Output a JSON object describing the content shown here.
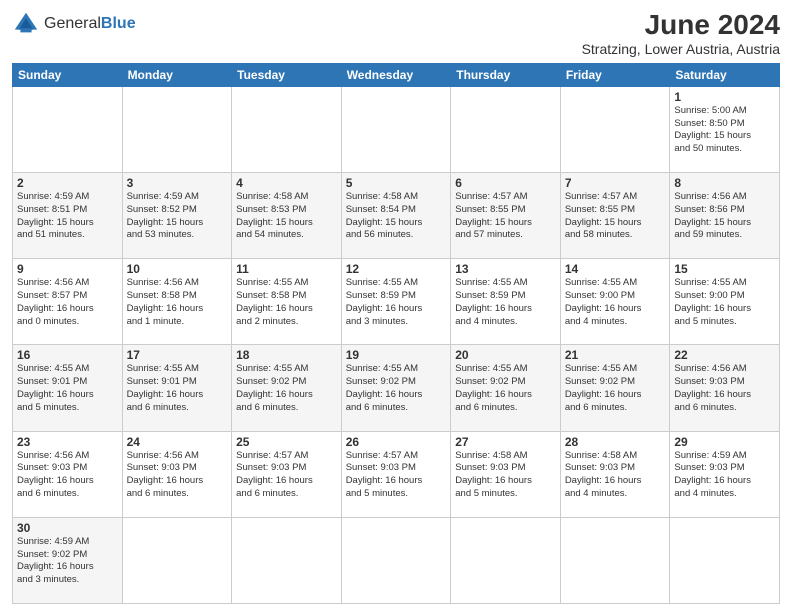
{
  "logo": {
    "text_general": "General",
    "text_blue": "Blue"
  },
  "title": "June 2024",
  "subtitle": "Stratzing, Lower Austria, Austria",
  "days_of_week": [
    "Sunday",
    "Monday",
    "Tuesday",
    "Wednesday",
    "Thursday",
    "Friday",
    "Saturday"
  ],
  "weeks": [
    [
      {
        "day": "",
        "info": ""
      },
      {
        "day": "",
        "info": ""
      },
      {
        "day": "",
        "info": ""
      },
      {
        "day": "",
        "info": ""
      },
      {
        "day": "",
        "info": ""
      },
      {
        "day": "",
        "info": ""
      },
      {
        "day": "1",
        "info": "Sunrise: 5:00 AM\nSunset: 8:50 PM\nDaylight: 15 hours\nand 50 minutes."
      }
    ],
    [
      {
        "day": "2",
        "info": "Sunrise: 4:59 AM\nSunset: 8:51 PM\nDaylight: 15 hours\nand 51 minutes."
      },
      {
        "day": "3",
        "info": "Sunrise: 4:59 AM\nSunset: 8:52 PM\nDaylight: 15 hours\nand 53 minutes."
      },
      {
        "day": "4",
        "info": "Sunrise: 4:58 AM\nSunset: 8:53 PM\nDaylight: 15 hours\nand 54 minutes."
      },
      {
        "day": "5",
        "info": "Sunrise: 4:58 AM\nSunset: 8:54 PM\nDaylight: 15 hours\nand 56 minutes."
      },
      {
        "day": "6",
        "info": "Sunrise: 4:57 AM\nSunset: 8:55 PM\nDaylight: 15 hours\nand 57 minutes."
      },
      {
        "day": "7",
        "info": "Sunrise: 4:57 AM\nSunset: 8:55 PM\nDaylight: 15 hours\nand 58 minutes."
      },
      {
        "day": "8",
        "info": "Sunrise: 4:56 AM\nSunset: 8:56 PM\nDaylight: 15 hours\nand 59 minutes."
      }
    ],
    [
      {
        "day": "9",
        "info": "Sunrise: 4:56 AM\nSunset: 8:57 PM\nDaylight: 16 hours\nand 0 minutes."
      },
      {
        "day": "10",
        "info": "Sunrise: 4:56 AM\nSunset: 8:58 PM\nDaylight: 16 hours\nand 1 minute."
      },
      {
        "day": "11",
        "info": "Sunrise: 4:55 AM\nSunset: 8:58 PM\nDaylight: 16 hours\nand 2 minutes."
      },
      {
        "day": "12",
        "info": "Sunrise: 4:55 AM\nSunset: 8:59 PM\nDaylight: 16 hours\nand 3 minutes."
      },
      {
        "day": "13",
        "info": "Sunrise: 4:55 AM\nSunset: 8:59 PM\nDaylight: 16 hours\nand 4 minutes."
      },
      {
        "day": "14",
        "info": "Sunrise: 4:55 AM\nSunset: 9:00 PM\nDaylight: 16 hours\nand 4 minutes."
      },
      {
        "day": "15",
        "info": "Sunrise: 4:55 AM\nSunset: 9:00 PM\nDaylight: 16 hours\nand 5 minutes."
      }
    ],
    [
      {
        "day": "16",
        "info": "Sunrise: 4:55 AM\nSunset: 9:01 PM\nDaylight: 16 hours\nand 5 minutes."
      },
      {
        "day": "17",
        "info": "Sunrise: 4:55 AM\nSunset: 9:01 PM\nDaylight: 16 hours\nand 6 minutes."
      },
      {
        "day": "18",
        "info": "Sunrise: 4:55 AM\nSunset: 9:02 PM\nDaylight: 16 hours\nand 6 minutes."
      },
      {
        "day": "19",
        "info": "Sunrise: 4:55 AM\nSunset: 9:02 PM\nDaylight: 16 hours\nand 6 minutes."
      },
      {
        "day": "20",
        "info": "Sunrise: 4:55 AM\nSunset: 9:02 PM\nDaylight: 16 hours\nand 6 minutes."
      },
      {
        "day": "21",
        "info": "Sunrise: 4:55 AM\nSunset: 9:02 PM\nDaylight: 16 hours\nand 6 minutes."
      },
      {
        "day": "22",
        "info": "Sunrise: 4:56 AM\nSunset: 9:03 PM\nDaylight: 16 hours\nand 6 minutes."
      }
    ],
    [
      {
        "day": "23",
        "info": "Sunrise: 4:56 AM\nSunset: 9:03 PM\nDaylight: 16 hours\nand 6 minutes."
      },
      {
        "day": "24",
        "info": "Sunrise: 4:56 AM\nSunset: 9:03 PM\nDaylight: 16 hours\nand 6 minutes."
      },
      {
        "day": "25",
        "info": "Sunrise: 4:57 AM\nSunset: 9:03 PM\nDaylight: 16 hours\nand 6 minutes."
      },
      {
        "day": "26",
        "info": "Sunrise: 4:57 AM\nSunset: 9:03 PM\nDaylight: 16 hours\nand 5 minutes."
      },
      {
        "day": "27",
        "info": "Sunrise: 4:58 AM\nSunset: 9:03 PM\nDaylight: 16 hours\nand 5 minutes."
      },
      {
        "day": "28",
        "info": "Sunrise: 4:58 AM\nSunset: 9:03 PM\nDaylight: 16 hours\nand 4 minutes."
      },
      {
        "day": "29",
        "info": "Sunrise: 4:59 AM\nSunset: 9:03 PM\nDaylight: 16 hours\nand 4 minutes."
      }
    ],
    [
      {
        "day": "30",
        "info": "Sunrise: 4:59 AM\nSunset: 9:02 PM\nDaylight: 16 hours\nand 3 minutes."
      },
      {
        "day": "",
        "info": ""
      },
      {
        "day": "",
        "info": ""
      },
      {
        "day": "",
        "info": ""
      },
      {
        "day": "",
        "info": ""
      },
      {
        "day": "",
        "info": ""
      },
      {
        "day": "",
        "info": ""
      }
    ]
  ]
}
